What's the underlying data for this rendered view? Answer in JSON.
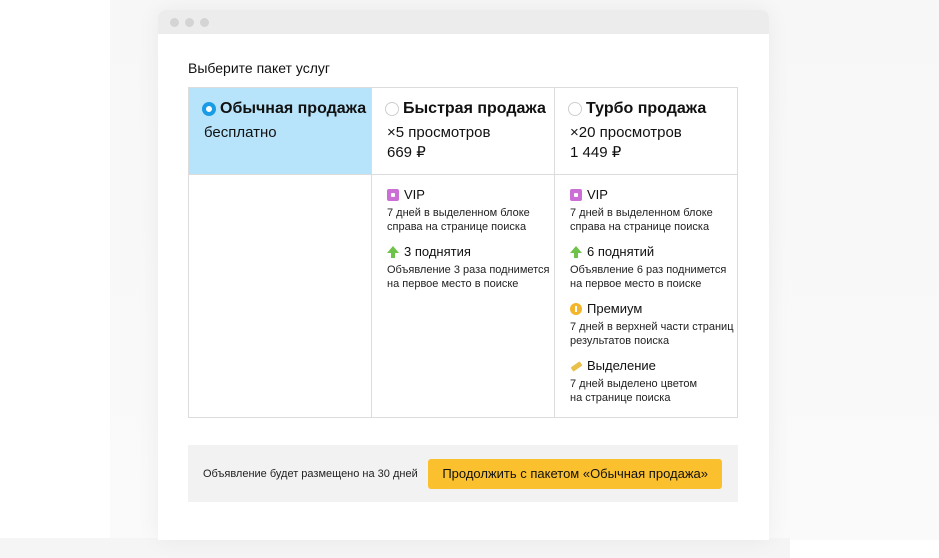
{
  "page": {
    "heading": "Выберите пакет услуг"
  },
  "packages": [
    {
      "title": "Обычная продажа",
      "line1": "бесплатно",
      "line2": "",
      "selected": true
    },
    {
      "title": "Быстрая продажа",
      "line1": "×5 просмотров",
      "line2": "669 ₽",
      "selected": false
    },
    {
      "title": "Турбо продажа",
      "line1": "×20 просмотров",
      "line2": "1 449 ₽",
      "selected": false
    }
  ],
  "features": {
    "fast": [
      {
        "icon": "vip-icon",
        "title": "VIP",
        "desc1": "7 дней в выделенном блоке",
        "desc2": "справа на странице поиска"
      },
      {
        "icon": "arrow-up-icon",
        "title": "3 поднятия",
        "desc1": "Объявление 3 раза поднимется",
        "desc2": "на первое место в поиске"
      }
    ],
    "turbo": [
      {
        "icon": "vip-icon",
        "title": "VIP",
        "desc1": "7 дней в выделенном блоке",
        "desc2": "справа на странице поиска"
      },
      {
        "icon": "arrow-up-icon",
        "title": "6 поднятий",
        "desc1": "Объявление 6 раз поднимется",
        "desc2": "на первое место в поиске"
      },
      {
        "icon": "premium-icon",
        "title": "Премиум",
        "desc1": "7 дней в верхней части страниц",
        "desc2": "результатов поиска"
      },
      {
        "icon": "highlight-icon",
        "title": "Выделение",
        "desc1": "7 дней выделено цветом",
        "desc2": "на странице поиска"
      }
    ]
  },
  "footer": {
    "text": "Объявление будет размещено на 30 дней",
    "cta_label": "Продолжить с пакетом «Обычная продажа»"
  },
  "colors": {
    "selected_bg": "#b7e4fb",
    "radio_on": "#1a9be6",
    "cta_bg": "#fbc02d"
  }
}
